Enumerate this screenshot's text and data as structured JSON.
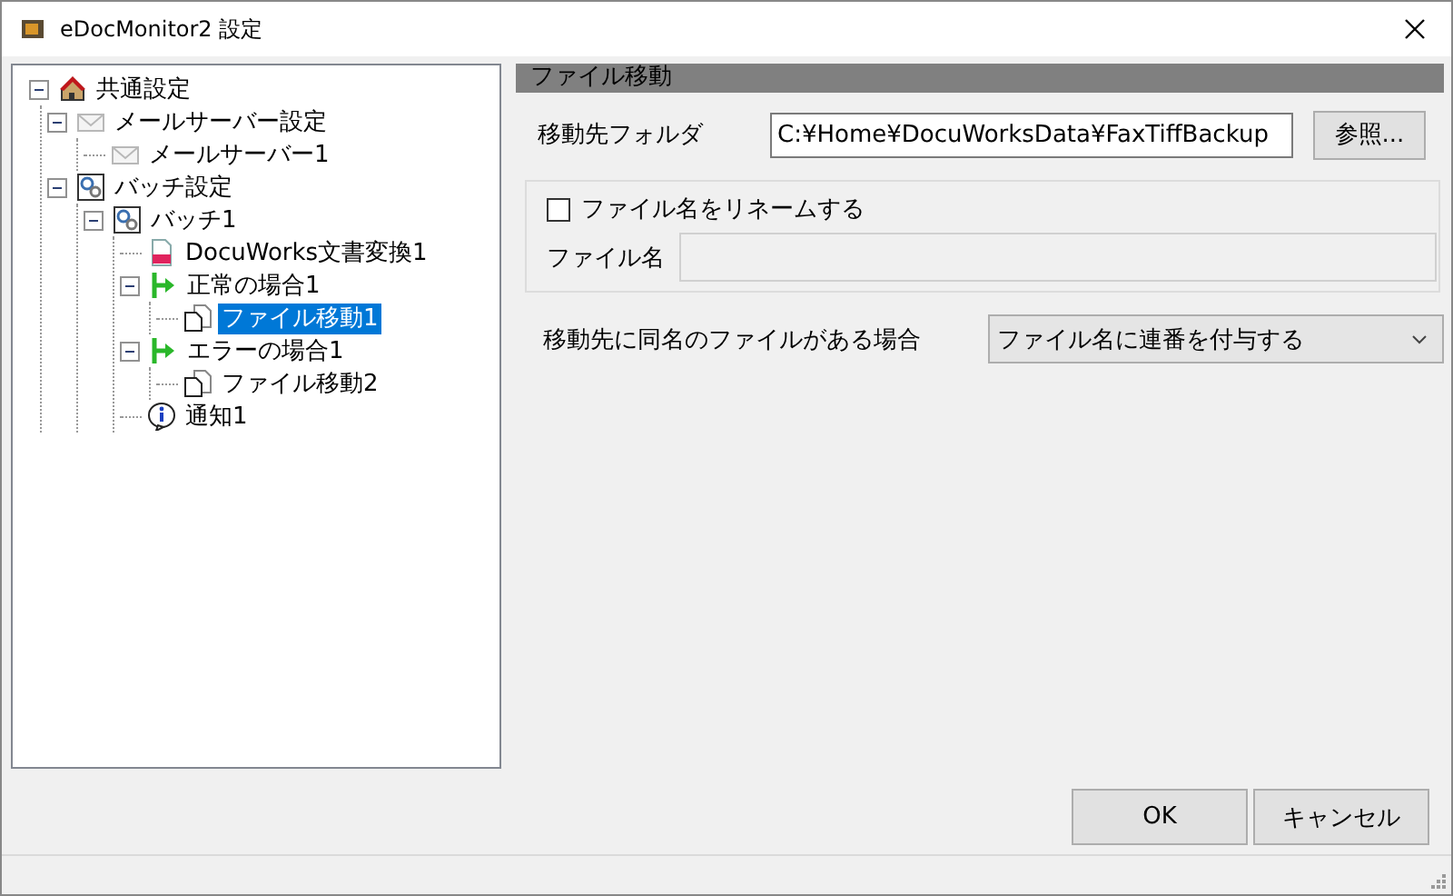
{
  "window": {
    "title": "eDocMonitor2 設定"
  },
  "tree": [
    {
      "label": "共通設定",
      "kind": "home",
      "expanded": true,
      "selected": false,
      "children": [
        {
          "label": "メールサーバー設定",
          "kind": "mail",
          "expanded": true,
          "selected": false,
          "children": [
            {
              "label": "メールサーバー1",
              "kind": "mail",
              "selected": false
            }
          ]
        },
        {
          "label": "バッチ設定",
          "kind": "batch",
          "expanded": true,
          "selected": false,
          "children": [
            {
              "label": "バッチ1",
              "kind": "batch",
              "expanded": true,
              "selected": false,
              "children": [
                {
                  "label": "DocuWorks文書変換1",
                  "kind": "doc",
                  "selected": false
                },
                {
                  "label": "正常の場合1",
                  "kind": "branch",
                  "expanded": true,
                  "selected": false,
                  "children": [
                    {
                      "label": "ファイル移動1",
                      "kind": "file",
                      "selected": true
                    }
                  ]
                },
                {
                  "label": "エラーの場合1",
                  "kind": "branch",
                  "expanded": true,
                  "selected": false,
                  "children": [
                    {
                      "label": "ファイル移動2",
                      "kind": "file",
                      "selected": false
                    }
                  ]
                },
                {
                  "label": "通知1",
                  "kind": "info",
                  "selected": false
                }
              ]
            }
          ]
        }
      ]
    }
  ],
  "panel": {
    "title": "ファイル移動",
    "folder": {
      "label": "移動先フォルダ",
      "value": "C:¥Home¥DocuWorksData¥FaxTiffBackup",
      "button": "参照..."
    },
    "rename": {
      "label": "ファイル名をリネームする",
      "checked": false
    },
    "filename": {
      "label": "ファイル名",
      "disabled": true
    },
    "conflict": {
      "label": "移動先に同名のファイルがある場合",
      "value": "ファイル名に連番を付与する"
    }
  },
  "buttons": [
    "OK",
    "キャンセル"
  ]
}
